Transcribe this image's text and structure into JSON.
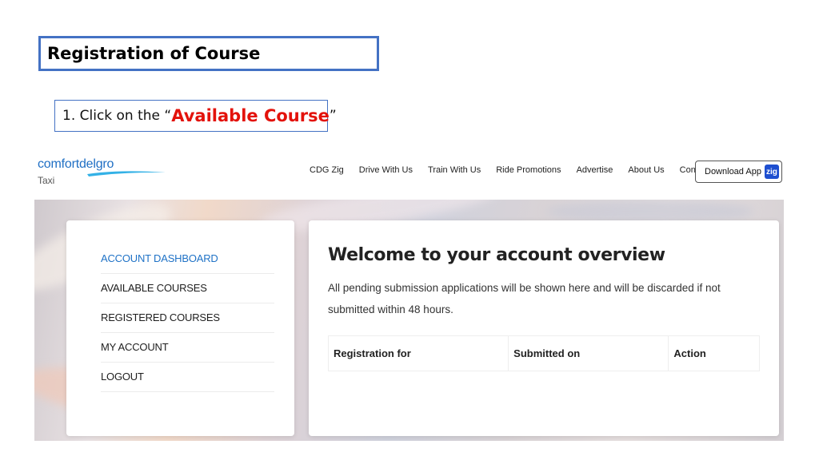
{
  "slide": {
    "title": "Registration of Course",
    "instruction": {
      "prefix": "1. Click on the “",
      "highlight": "Available Course",
      "suffix": "”",
      "highlight_color": "#e3120b"
    }
  },
  "site": {
    "logo": {
      "name": "comfortdelgro",
      "sub": "Taxi",
      "color": "#1f6fc4"
    },
    "nav": [
      {
        "label": "CDG Zig"
      },
      {
        "label": "Drive With Us"
      },
      {
        "label": "Train With Us"
      },
      {
        "label": "Ride Promotions"
      },
      {
        "label": "Advertise"
      },
      {
        "label": "About Us"
      },
      {
        "label": "Contact"
      }
    ],
    "download": {
      "label": "Download App",
      "badge": "zig",
      "badge_color": "#1e4fd0"
    }
  },
  "sidebar": {
    "active_color": "#1f72c6",
    "items": [
      {
        "label": "ACCOUNT DASHBOARD",
        "active": true
      },
      {
        "label": "AVAILABLE COURSES",
        "active": false
      },
      {
        "label": "REGISTERED COURSES",
        "active": false
      },
      {
        "label": "MY ACCOUNT",
        "active": false
      },
      {
        "label": "LOGOUT",
        "active": false
      }
    ]
  },
  "main": {
    "title": "Welcome to your account overview",
    "description": "All pending submission applications will be shown here and will be discarded if not submitted within 48 hours.",
    "table": {
      "headers": [
        "Registration for",
        "Submitted on",
        "Action"
      ]
    }
  }
}
